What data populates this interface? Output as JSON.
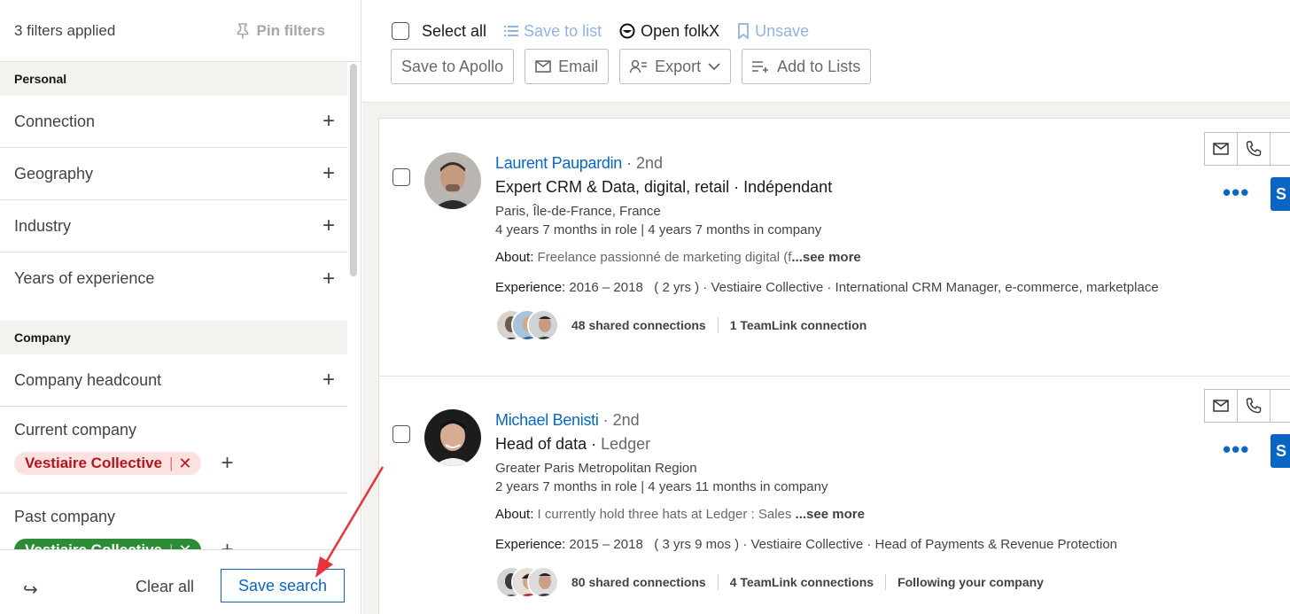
{
  "left_panel": {
    "filters_applied": "3 filters applied",
    "pin_filters": "Pin filters",
    "sections": {
      "personal": "Personal",
      "company": "Company"
    },
    "personal_filters": [
      "Connection",
      "Geography",
      "Industry",
      "Years of experience"
    ],
    "company_headcount": "Company headcount",
    "current_company": {
      "label": "Current company",
      "chip": "Vestiaire Collective",
      "chip_remove": "✕"
    },
    "past_company": {
      "label": "Past company",
      "chip": "Vestiaire Collective",
      "chip_remove": "✕"
    },
    "plus": "+",
    "footer": {
      "share_icon": "↪",
      "clear_all": "Clear all",
      "save_search": "Save search"
    }
  },
  "toolbar": {
    "select_all": "Select all",
    "save_to_list": "Save to list",
    "open_folkx": "Open folkX",
    "unsave": "Unsave",
    "save_to_apollo": "Save to Apollo",
    "email": "Email",
    "export": "Export",
    "add_to_lists": "Add to Lists"
  },
  "results": [
    {
      "name": "Laurent Paupardin",
      "degree": "· 2nd",
      "headline": "Expert CRM & Data, digital, retail · Indépendant",
      "location": "Paris, Île-de-France, France",
      "tenure": "4 years 7 months in role | 4 years 7 months in company",
      "about_label": "About:",
      "about_text": "Freelance passionné de marketing digital (f",
      "see_more": "...see more",
      "experience_label": "Experience:",
      "experience_text": "2016 – 2018   ( 2 yrs ) · Vestiaire Collective · International CRM Manager, e-commerce, marketplace",
      "shared_connections": "48 shared connections",
      "teamlink": "1 TeamLink connection",
      "following": "",
      "button_initial": "S"
    },
    {
      "name": "Michael Benisti",
      "degree": "· 2nd",
      "headline": "Head of data · ",
      "company": "Ledger",
      "location": "Greater Paris Metropolitan Region",
      "tenure": "2 years 7 months in role | 4 years 11 months in company",
      "about_label": "About:",
      "about_text": "I currently hold three hats at Ledger : Sales ",
      "see_more": "...see more",
      "experience_label": "Experience:",
      "experience_text": "2015 – 2018   ( 3 yrs 9 mos ) · Vestiaire Collective · Head of Payments & Revenue Protection",
      "shared_connections": "80 shared connections",
      "teamlink": "4 TeamLink connections",
      "following": "Following your company",
      "button_initial": "S"
    }
  ],
  "more_actions": "•••",
  "colors": {
    "linkedin_blue": "#0a66c2",
    "chip_red_bg": "#fbe1e0",
    "chip_red_text": "#b2161d",
    "chip_green": "#2e8c38",
    "annotation_arrow": "#e8323c"
  }
}
